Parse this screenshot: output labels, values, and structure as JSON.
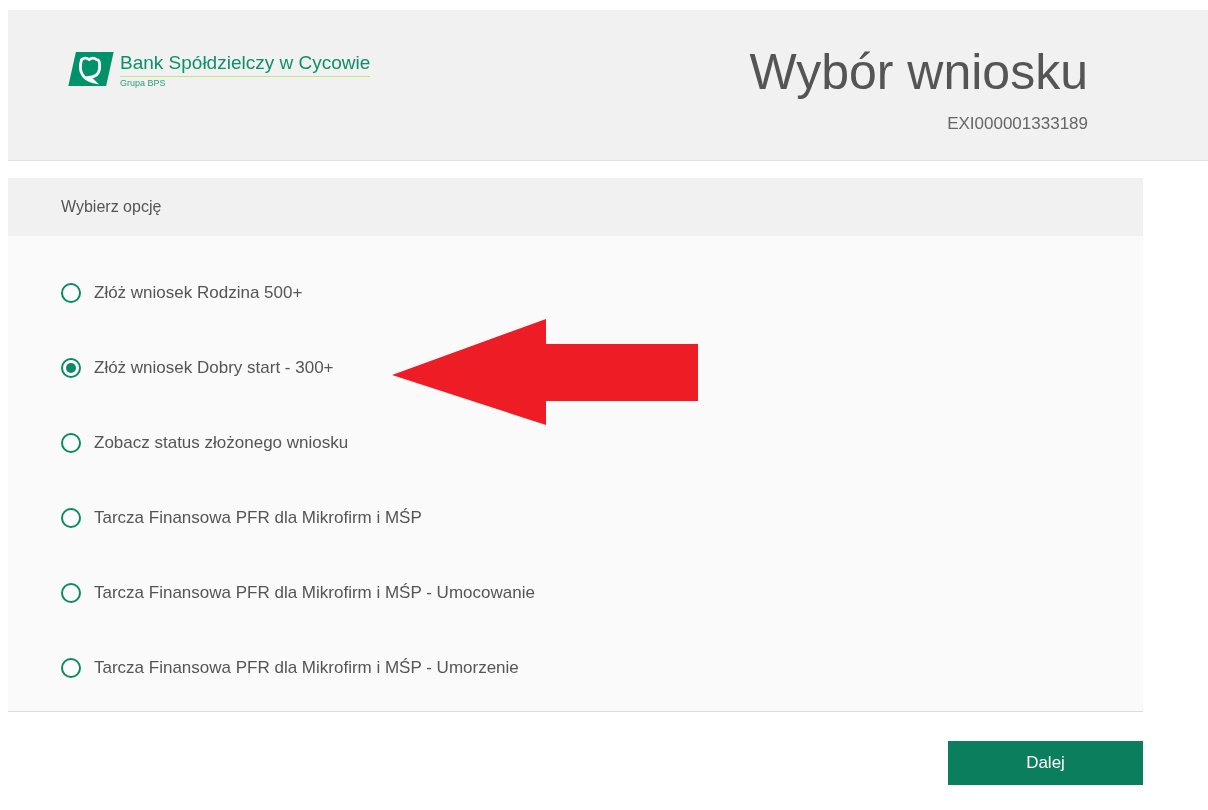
{
  "header": {
    "bank_name": "Bank Spółdzielczy w Cycowie",
    "bank_group": "Grupa BPS",
    "title": "Wybór wniosku",
    "reference": "EXI000001333189"
  },
  "panel": {
    "heading": "Wybierz opcję",
    "options": [
      {
        "label": "Złóż wniosek Rodzina 500+",
        "selected": false
      },
      {
        "label": "Złóż wniosek Dobry start - 300+",
        "selected": true
      },
      {
        "label": "Zobacz status złożonego wniosku",
        "selected": false
      },
      {
        "label": "Tarcza Finansowa PFR dla Mikrofirm i MŚP",
        "selected": false
      },
      {
        "label": "Tarcza Finansowa PFR dla Mikrofirm i MŚP - Umocowanie",
        "selected": false
      },
      {
        "label": "Tarcza Finansowa PFR dla Mikrofirm i MŚP - Umorzenie",
        "selected": false
      }
    ]
  },
  "next_button": "Dalej"
}
